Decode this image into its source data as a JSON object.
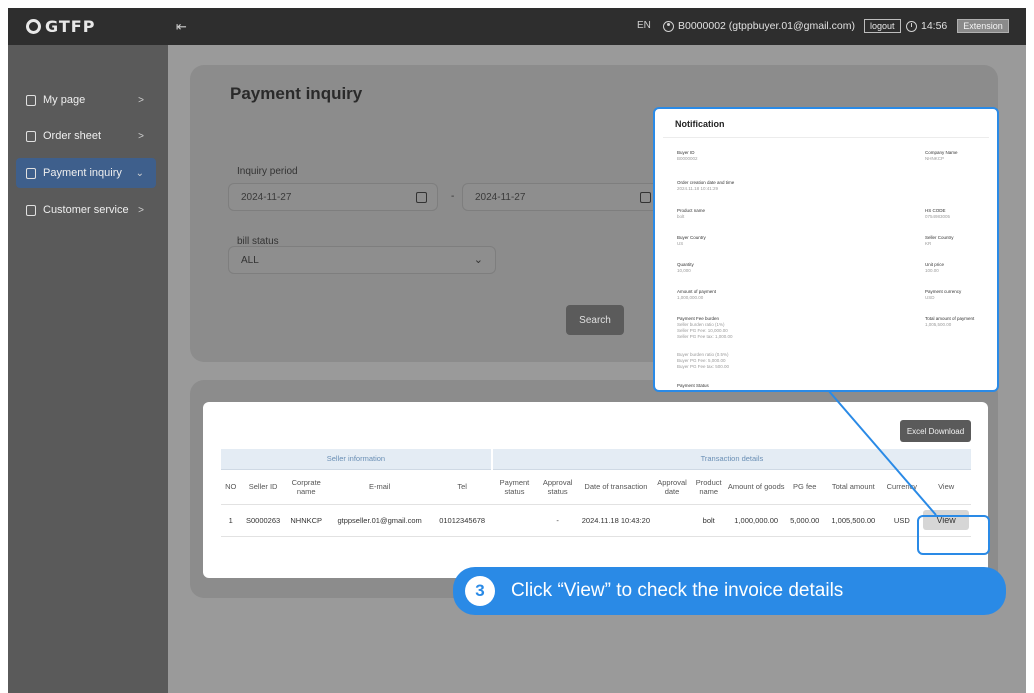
{
  "header": {
    "logo_text": "GTFP",
    "menu_icon": "menu-collapse-icon",
    "language": "EN",
    "user": "B0000002 (gtppbuyer.01@gmail.com)",
    "logout_label": "logout",
    "time": "14:56",
    "extension_label": "Extension"
  },
  "sidebar": {
    "items": [
      {
        "label": "My page",
        "icon": "person-icon"
      },
      {
        "label": "Order sheet",
        "icon": "document-icon"
      },
      {
        "label": "Payment inquiry",
        "icon": "payment-icon"
      },
      {
        "label": "Customer service",
        "icon": "support-icon"
      }
    ],
    "active_index": 2
  },
  "main": {
    "title": "Payment inquiry",
    "inquiry_period_label": "Inquiry period",
    "date_from": "2024-11-27",
    "date_to": "2024-11-27",
    "date_separator": "-",
    "bill_status_label": "bill status",
    "bill_status_value": "ALL",
    "search_label": "Search"
  },
  "table": {
    "excel_label": "Excel Download",
    "group_seller": "Seller information",
    "group_tx": "Transaction details",
    "headers": [
      "NO",
      "Seller ID",
      "Corprate name",
      "E-mail",
      "Tel",
      "Payment status",
      "Approval status",
      "Date of transaction",
      "Approval date",
      "Product name",
      "Amount of goods",
      "PG fee",
      "Total amount",
      "Currency",
      "View"
    ],
    "rows": [
      [
        "1",
        "S0000263",
        "NHNKCP",
        "gtppseller.01@gmail.com",
        "01012345678",
        "",
        "-",
        "2024.11.18 10:43:20",
        "",
        "bolt",
        "1,000,000.00",
        "5,000.00",
        "1,005,500.00",
        "USD",
        "View"
      ]
    ]
  },
  "notification": {
    "title": "Notification",
    "fields": {
      "buyer_id_label": "Buyer ID",
      "buyer_id": "B0000002",
      "company_label": "Company Name",
      "company": "NHNKCP",
      "order_dt_label": "Order creation date and time",
      "order_dt": "2024.11.18 10:41:29",
      "product_label": "Product name",
      "product": "bolt",
      "hs_label": "HS CODE",
      "hs": "0754983005",
      "buyer_country_label": "Buyer Country",
      "buyer_country": "US",
      "seller_country_label": "Seller Country",
      "seller_country": "KR",
      "qty_label": "Quantity",
      "qty": "10,000",
      "unit_label": "Unit price",
      "unit": "100.00",
      "amount_label": "Amount of payment",
      "amount": "1,000,000.00",
      "currency_label": "Payment currency",
      "currency": "USD",
      "fee_label": "Payment Fee burden",
      "fee_l1": "Seller burden ratio (1%)",
      "fee_l2": "Seller PG Fee: 10,000.00",
      "fee_l3": "Seller PG Fee tax: 1,000.00",
      "fee_l4": "Buyer burden ratio (0.5%)",
      "fee_l5": "Buyer PG Fee: 5,000.00",
      "fee_l6": "Buyer PG Fee tax: 500.00",
      "total_label": "Total amount of payment",
      "total": "1,005,500.00",
      "status_label": "Payment Status"
    }
  },
  "callout": {
    "number": "3",
    "text": "Click “View” to check the invoice details",
    "color": "#2a8ae6"
  }
}
